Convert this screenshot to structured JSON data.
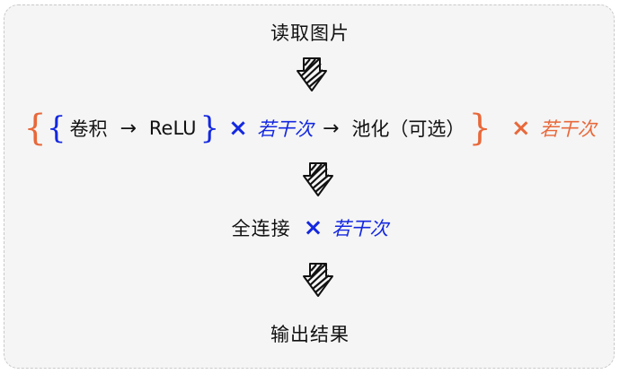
{
  "steps": {
    "read": "读取图片",
    "conv": "卷积",
    "relu": "ReLU",
    "pool": "池化（可选）",
    "fc": "全连接",
    "output": "输出结果"
  },
  "symbols": {
    "right_arrow": "→",
    "times": "×",
    "left_brace": "{",
    "right_brace": "}"
  },
  "repeat_label": "若干次",
  "colors": {
    "blue": "#1428e0",
    "orange": "#e8683a",
    "frame": "#f5f5f5"
  },
  "icons": [
    "hatched-down-arrow-icon"
  ]
}
